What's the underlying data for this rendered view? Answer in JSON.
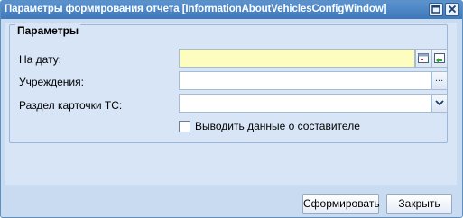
{
  "window": {
    "title": "Параметры формирования отчета [InformationAboutVehiclesConfigWindow]"
  },
  "fieldset": {
    "legend": "Параметры"
  },
  "fields": {
    "date_label": "На дату:",
    "date_value": "",
    "institution_label": "Учреждения:",
    "institution_value": "",
    "section_label": "Раздел карточки ТС:",
    "section_value": "",
    "browse_glyph": "..."
  },
  "checkbox": {
    "label": "Выводить данные о составителе",
    "checked": false
  },
  "buttons": {
    "generate": "Сформировать",
    "close": "Закрыть"
  },
  "colors": {
    "title_bar": "#4a86c7",
    "panel": "#d7e5f7",
    "date_field": "#fdfdc0"
  }
}
